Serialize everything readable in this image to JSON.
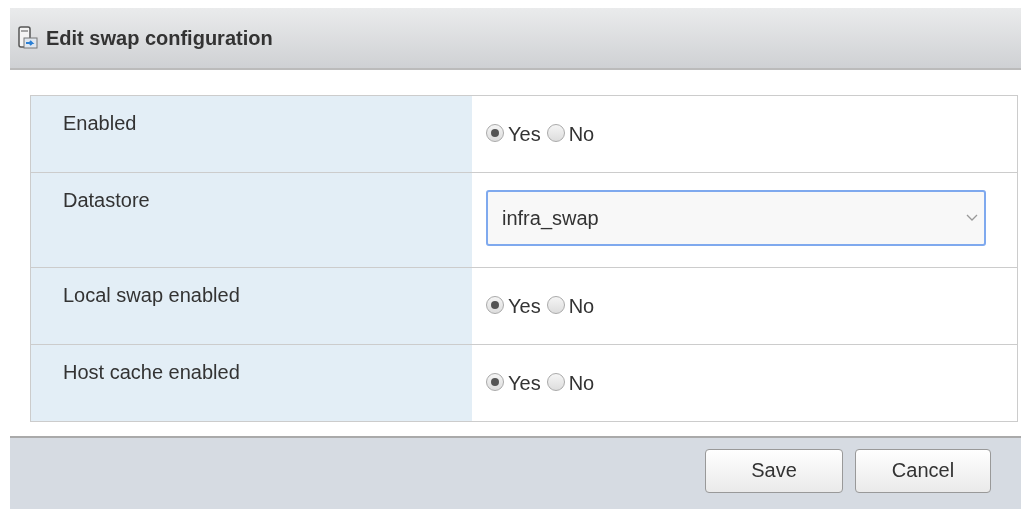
{
  "dialog": {
    "title": "Edit swap configuration"
  },
  "rows": [
    {
      "label": "Enabled",
      "kind": "radio",
      "options": [
        {
          "label": "Yes",
          "selected": true
        },
        {
          "label": "No",
          "selected": false
        }
      ]
    },
    {
      "label": "Datastore",
      "kind": "select",
      "value": "infra_swap"
    },
    {
      "label": "Local swap enabled",
      "kind": "radio",
      "options": [
        {
          "label": "Yes",
          "selected": true
        },
        {
          "label": "No",
          "selected": false
        }
      ]
    },
    {
      "label": "Host cache enabled",
      "kind": "radio",
      "options": [
        {
          "label": "Yes",
          "selected": true
        },
        {
          "label": "No",
          "selected": false
        }
      ]
    }
  ],
  "buttons": [
    "Save",
    "Cancel"
  ]
}
